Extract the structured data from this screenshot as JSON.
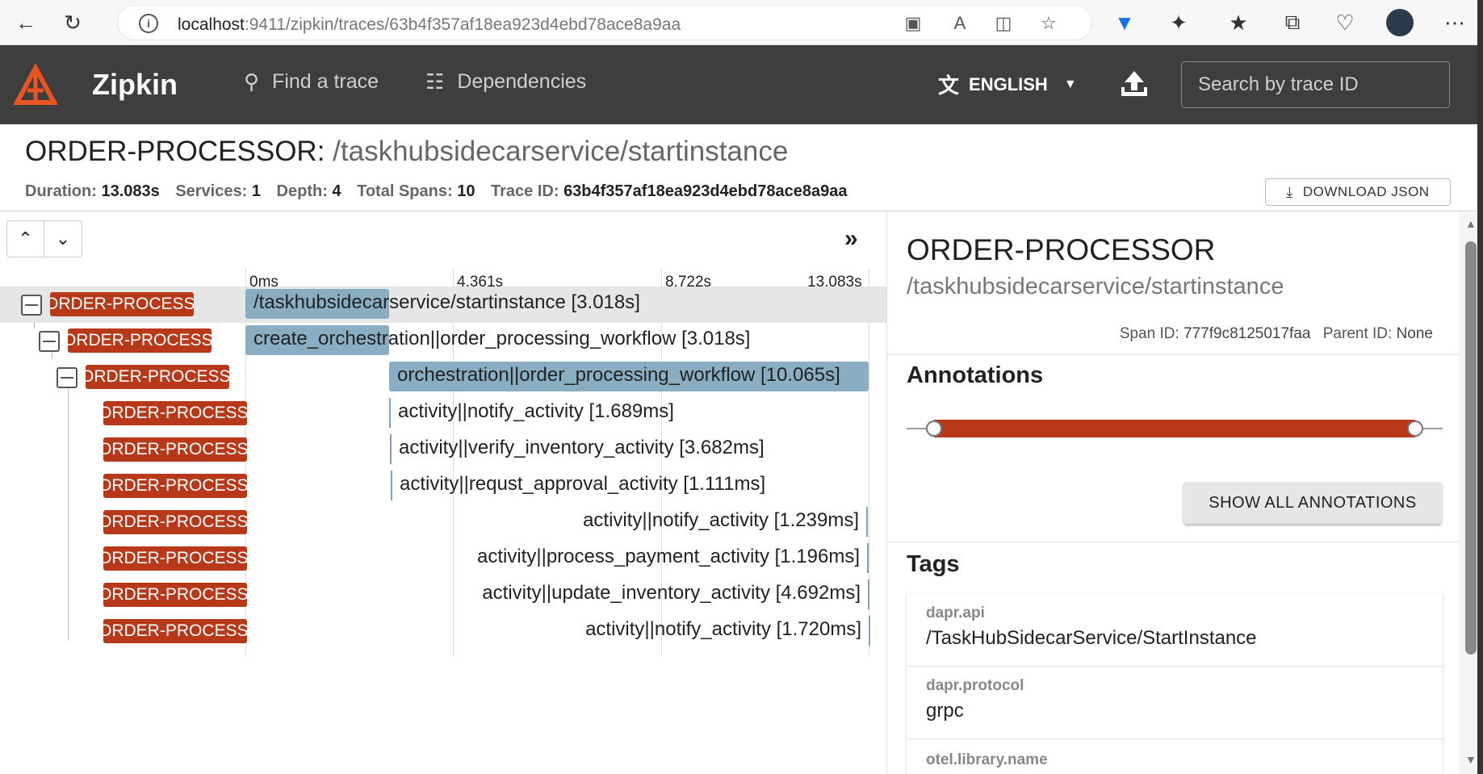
{
  "browser": {
    "url_host": "localhost",
    "url_path": ":9411/zipkin/traces/63b4f357af18ea923d4ebd78ace8a9aa"
  },
  "header": {
    "brand": "Zipkin",
    "nav_find": "Find a trace",
    "nav_deps": "Dependencies",
    "language": "ENGLISH",
    "search_placeholder": "Search by trace ID"
  },
  "trace": {
    "service": "ORDER-PROCESSOR:",
    "path": " /taskhubsidecarservice/startinstance",
    "duration_label": "Duration:",
    "duration": "13.083s",
    "services_label": "Services:",
    "services": "1",
    "depth_label": "Depth:",
    "depth": "4",
    "spans_label": "Total Spans:",
    "spans": "10",
    "traceid_label": "Trace ID:",
    "traceid": "63b4f357af18ea923d4ebd78ace8a9aa",
    "download": "DOWNLOAD JSON"
  },
  "timeline": {
    "ticks": [
      "0ms",
      "4.361s",
      "8.722s",
      "13.083s"
    ],
    "rows": [
      {
        "service": "ORDER-PROCESSOR",
        "label": "/taskhubsidecarservice/startinstance [3.018s]"
      },
      {
        "service": "ORDER-PROCESSOR",
        "label": "create_orchestration||order_processing_workflow [3.018s]"
      },
      {
        "service": "ORDER-PROCESSOR",
        "label": "orchestration||order_processing_workflow [10.065s]"
      },
      {
        "service": "ORDER-PROCESSOR",
        "label": "activity||notify_activity [1.689ms]"
      },
      {
        "service": "ORDER-PROCESSOR",
        "label": "activity||verify_inventory_activity [3.682ms]"
      },
      {
        "service": "ORDER-PROCESSOR",
        "label": "activity||requst_approval_activity [1.111ms]"
      },
      {
        "service": "ORDER-PROCESSOR",
        "label": "activity||notify_activity [1.239ms]"
      },
      {
        "service": "ORDER-PROCESSOR",
        "label": "activity||process_payment_activity [1.196ms]"
      },
      {
        "service": "ORDER-PROCESSOR",
        "label": "activity||update_inventory_activity [4.692ms]"
      },
      {
        "service": "ORDER-PROCESSOR",
        "label": "activity||notify_activity [1.720ms]"
      }
    ]
  },
  "detail": {
    "service": "ORDER-PROCESSOR",
    "path": "/taskhubsidecarservice/startinstance",
    "span_id_label": "Span ID:",
    "span_id": "777f9c8125017faa",
    "parent_id_label": "Parent ID:",
    "parent_id": "None",
    "annotations_heading": "Annotations",
    "show_all": "SHOW ALL ANNOTATIONS",
    "tags_heading": "Tags",
    "tags": [
      {
        "key": "dapr.api",
        "value": "/TaskHubSidecarService/StartInstance"
      },
      {
        "key": "dapr.protocol",
        "value": "grpc"
      },
      {
        "key": "otel.library.name",
        "value": ""
      }
    ]
  },
  "colors": {
    "accent": "#b8391a",
    "span_bar": "#89aec3",
    "header_bg": "#3e3e3e"
  }
}
